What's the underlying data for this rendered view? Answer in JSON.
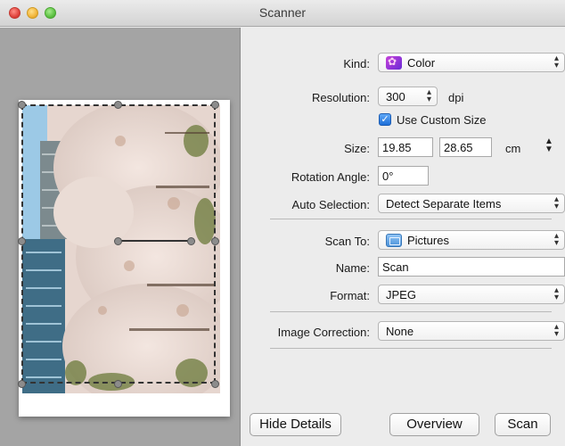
{
  "window": {
    "title": "Scanner"
  },
  "details": {
    "kind": {
      "label": "Kind:",
      "value": "Color",
      "icon": "color-palette-icon"
    },
    "resolution": {
      "label": "Resolution:",
      "value": "300",
      "unit": "dpi"
    },
    "use_custom_size": {
      "label": "Use Custom Size",
      "checked": true
    },
    "size": {
      "label": "Size:",
      "width": "19.85",
      "height": "28.65",
      "unit": "cm"
    },
    "rotation": {
      "label": "Rotation Angle:",
      "value": "0°"
    },
    "auto_selection": {
      "label": "Auto Selection:",
      "value": "Detect Separate Items"
    },
    "scan_to": {
      "label": "Scan To:",
      "value": "Pictures",
      "icon": "pictures-folder-icon"
    },
    "name": {
      "label": "Name:",
      "value": "Scan"
    },
    "format": {
      "label": "Format:",
      "value": "JPEG"
    },
    "image_correction": {
      "label": "Image Correction:",
      "value": "None"
    }
  },
  "buttons": {
    "hide_details": "Hide Details",
    "overview": "Overview",
    "scan": "Scan"
  },
  "colors": {
    "accent": "#1e6fd8",
    "preview_background": "#a4a4a4",
    "panel_background": "#ececec"
  }
}
